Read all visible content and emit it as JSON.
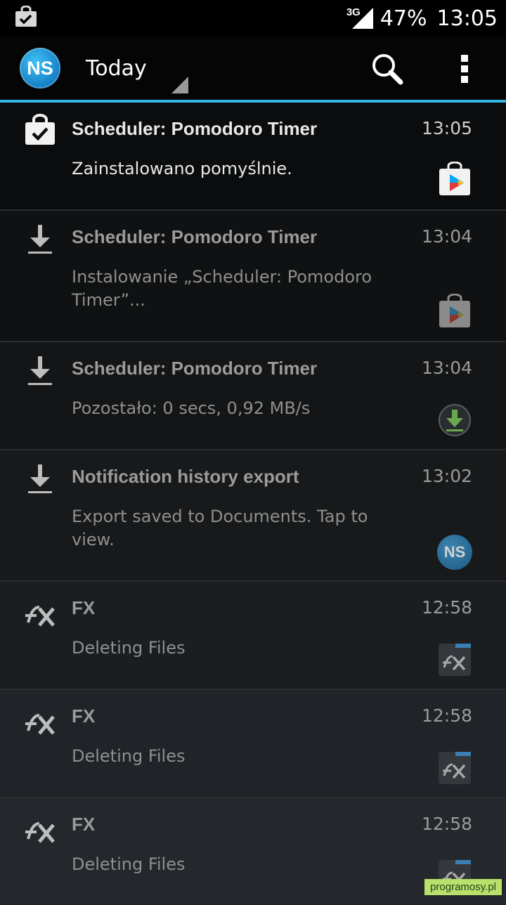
{
  "status_bar": {
    "left_icon": "shopping-bag-check-icon",
    "network": "3G",
    "battery": "47%",
    "time": "13:05"
  },
  "action_bar": {
    "avatar_text": "NS",
    "filter_label": "Today",
    "search_icon": "search-icon",
    "overflow_icon": "overflow-menu-icon",
    "accent_color": "#33b5e5"
  },
  "notifications": [
    {
      "icon": "shopping-bag-check-icon",
      "title": "Scheduler: Pomodoro Timer",
      "time": "13:05",
      "body": "Zainstalowano pomyślnie.",
      "app_icon": "play-store-icon"
    },
    {
      "icon": "download-icon",
      "title": "Scheduler: Pomodoro Timer",
      "time": "13:04",
      "body": "Instalowanie „Scheduler: Pomodoro Timer”...",
      "app_icon": "play-store-icon"
    },
    {
      "icon": "download-icon",
      "title": "Scheduler: Pomodoro Timer",
      "time": "13:04",
      "body": "Pozostało: 0 secs, 0,92 MB/s",
      "app_icon": "download-manager-icon"
    },
    {
      "icon": "download-icon",
      "title": "Notification history export",
      "time": "13:02",
      "body": "Export saved to Documents. Tap to view.",
      "app_icon": "ns-app-icon",
      "app_icon_text": "NS"
    },
    {
      "icon": "fx-icon",
      "title": "FX",
      "time": "12:58",
      "body": "Deleting Files",
      "app_icon": "fx-app-icon",
      "app_icon_text": "FX"
    },
    {
      "icon": "fx-icon",
      "title": "FX",
      "time": "12:58",
      "body": "Deleting Files",
      "app_icon": "fx-app-icon",
      "app_icon_text": "FX"
    },
    {
      "icon": "fx-icon",
      "title": "FX",
      "time": "12:58",
      "body": "Deleting Files",
      "app_icon": "fx-app-icon",
      "app_icon_text": "FX"
    }
  ],
  "watermark": "programosy.pl"
}
